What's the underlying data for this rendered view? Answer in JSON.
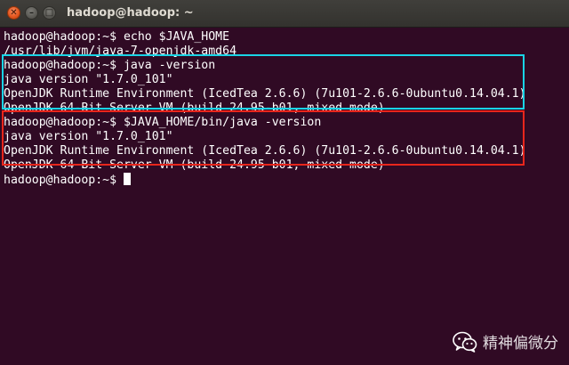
{
  "window": {
    "title": "hadoop@hadoop: ~",
    "close_glyph": "✕",
    "minimize_glyph": "–",
    "maximize_glyph": "□"
  },
  "terminal": {
    "lines": [
      "hadoop@hadoop:~$ echo $JAVA_HOME",
      "/usr/lib/jvm/java-7-openjdk-amd64",
      "hadoop@hadoop:~$ java -version",
      "java version \"1.7.0_101\"",
      "OpenJDK Runtime Environment (IcedTea 2.6.6) (7u101-2.6.6-0ubuntu0.14.04.1)",
      "OpenJDK 64-Bit Server VM (build 24.95-b01, mixed mode)",
      "hadoop@hadoop:~$ $JAVA_HOME/bin/java -version",
      "java version \"1.7.0_101\"",
      "OpenJDK Runtime Environment (IcedTea 2.6.6) (7u101-2.6.6-0ubuntu0.14.04.1)",
      "OpenJDK 64-Bit Server VM (build 24.95-b01, mixed mode)",
      "hadoop@hadoop:~$ "
    ]
  },
  "highlights": {
    "first_color": "#19d4e6",
    "second_color": "#e8261c"
  },
  "watermark": {
    "text": "精神偏微分",
    "icon": "wechat-icon"
  },
  "colors": {
    "terminal_background": "#300a24",
    "terminal_text": "#ffffff"
  }
}
